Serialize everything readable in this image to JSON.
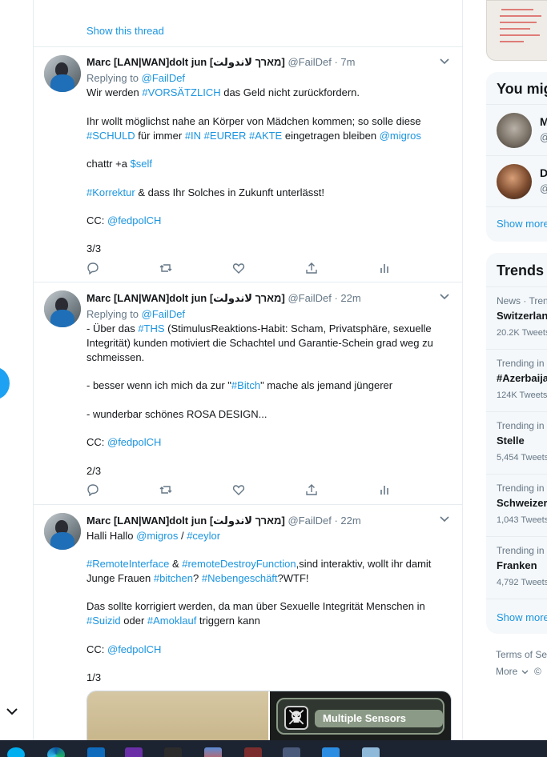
{
  "colors": {
    "accent": "#1b95e0",
    "border": "#e6ecf0",
    "muted": "#657786",
    "text": "#14171a",
    "taskbar": "#1c2331"
  },
  "previous_tweet": {
    "show_thread_label": "Show this thread"
  },
  "tweets": [
    {
      "name": "Marc [LAN|WAN]dolt jun [מארך لاندولت]",
      "handle": "@FailDef",
      "separator": "·",
      "time": "7m",
      "replying_label": "Replying to",
      "replying_to": "@FailDef",
      "p1": "Wir werden ",
      "p1_tag": "#VORSÄTZLICH",
      "p1_rest": " das Geld nicht zurückfordern.",
      "p2a": "Ihr wollt möglichst nahe an Körper von Mädchen kommen; so solle diese",
      "p2_tag1": "#SCHULD",
      "p2_mid1": " für immer ",
      "p2_tag2": "#IN",
      "p2_tag3": "#EURER",
      "p2_tag4": "#AKTE",
      "p2_mid2": "  eingetragen bleiben ",
      "p2_mention": "@migros",
      "p3": "chattr +a ",
      "p3_tag": "$self",
      "p4_tag": "#Korrektur",
      "p4_rest": " & dass Ihr Solches in Zukunft unterlässt!",
      "cc_label": "CC: ",
      "cc": "@fedpolCH",
      "count": "3/3"
    },
    {
      "name": "Marc [LAN|WAN]dolt jun [מארך لاندولت]",
      "handle": "@FailDef",
      "separator": "·",
      "time": "22m",
      "replying_label": "Replying to",
      "replying_to": "@FailDef",
      "p1a": "- Über das ",
      "p1_tag": "#THS",
      "p1b": " (StimulusReaktions-Habit: Scham, Privatsphäre, sexuelle Integrität) kunden motiviert die Schachtel und Garantie-Schein grad weg zu schmeissen.",
      "p2a": "- besser wenn ich mich da zur \"",
      "p2_tag": "#Bitch",
      "p2b": "\" mache als jemand jüngerer",
      "p3": "- wunderbar schönes ROSA DESIGN...",
      "cc_label": "CC: ",
      "cc": "@fedpolCH",
      "count": "2/3"
    },
    {
      "name": "Marc [LAN|WAN]dolt jun [מארך لاندولت]",
      "handle": "@FailDef",
      "separator": "·",
      "time": "22m",
      "p1a": "Halli Hallo ",
      "p1_mention": "@migros",
      "p1_sep": " / ",
      "p1_tag": "#ceylor",
      "p2_tag1": "#RemoteInterface",
      "p2_amp": " & ",
      "p2_tag2": "#remoteDestroyFunction",
      "p2b": ",sind interaktiv, wollt ihr damit Junge Frauen ",
      "p2_tag3": "#bitchen",
      "p2c": "? ",
      "p2_tag4": "#Nebengeschäft",
      "p2d": "?WTF!",
      "p3a": "Das sollte korrigiert werden, da man über Sexuelle Integrität Menschen in ",
      "p3_tag1": "#Suizid",
      "p3b": " oder ",
      "p3_tag2": "#Amoklauf",
      "p3c": " triggern kann",
      "cc_label": "CC: ",
      "cc": "@fedpolCH",
      "count": "1/3",
      "media_label": "Multiple Sensors"
    }
  ],
  "sidebar": {
    "you_might_like": {
      "title": "You mig",
      "items": [
        {
          "initial": "M",
          "handle": "@"
        },
        {
          "initial": "D",
          "handle": "@"
        }
      ],
      "show_more": "Show more"
    },
    "trends": {
      "title": "Trends",
      "items": [
        {
          "context": "News · Trend",
          "name": "Switzerlan",
          "count": "20.2K Tweets"
        },
        {
          "context": "Trending in",
          "name": "#Azerbaija",
          "count": "124K Tweets"
        },
        {
          "context": "Trending in",
          "name": "Stelle",
          "count": "5,454 Tweets"
        },
        {
          "context": "Trending in",
          "name": "Schweizer",
          "count": "1,043 Tweets"
        },
        {
          "context": "Trending in",
          "name": "Franken",
          "count": "4,792 Tweets"
        }
      ],
      "show_more": "Show more"
    },
    "footer": {
      "terms": "Terms of Ser",
      "more": "More",
      "copyright": "©"
    }
  },
  "icons": [
    "reply-icon",
    "retweet-icon",
    "like-icon",
    "share-icon",
    "analytics-icon",
    "caret-down-icon",
    "chevron-down-icon"
  ],
  "taskbar_apps": [
    "skype",
    "edge",
    "outlook",
    "visual-studio",
    "x-tool",
    "chart-app",
    "media-app",
    "prism-app",
    "photos",
    "files"
  ]
}
